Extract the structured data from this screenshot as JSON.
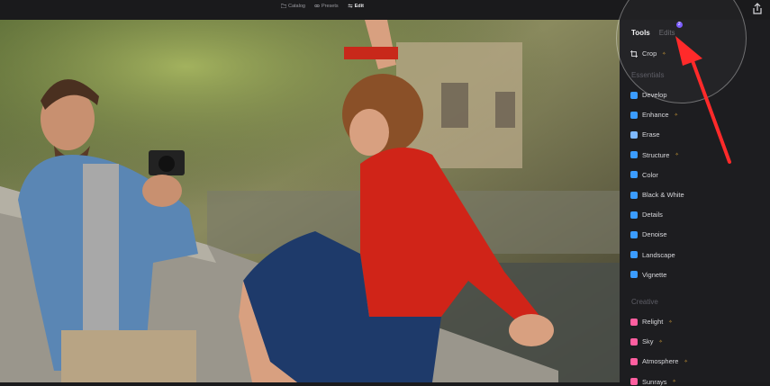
{
  "topbar": {
    "modes": [
      {
        "label": "Catalog",
        "icon": "folder-icon"
      },
      {
        "label": "Presets",
        "icon": "presets-icon"
      },
      {
        "label": "Edit",
        "icon": "edit-sliders-icon",
        "active": true
      }
    ]
  },
  "panel": {
    "tabs": {
      "tools": "Tools",
      "edits": "Edits",
      "edits_badge": "2"
    },
    "crop": "Crop",
    "sections": {
      "essentials": "Essentials",
      "creative": "Creative"
    },
    "essentials_items": [
      {
        "label": "Develop",
        "icon": "develop-icon",
        "color": "#3b9cff",
        "ai": false
      },
      {
        "label": "Enhance",
        "icon": "enhance-icon",
        "color": "#3b9cff",
        "ai": true
      },
      {
        "label": "Erase",
        "icon": "erase-icon",
        "color": "#7fb9ff",
        "ai": false
      },
      {
        "label": "Structure",
        "icon": "structure-icon",
        "color": "#3b9cff",
        "ai": true
      },
      {
        "label": "Color",
        "icon": "color-icon",
        "color": "#3b9cff",
        "ai": false
      },
      {
        "label": "Black & White",
        "icon": "black-white-icon",
        "color": "#3b9cff",
        "ai": false
      },
      {
        "label": "Details",
        "icon": "details-icon",
        "color": "#3b9cff",
        "ai": false
      },
      {
        "label": "Denoise",
        "icon": "denoise-icon",
        "color": "#3b9cff",
        "ai": false
      },
      {
        "label": "Landscape",
        "icon": "landscape-icon",
        "color": "#3b9cff",
        "ai": false
      },
      {
        "label": "Vignette",
        "icon": "vignette-icon",
        "color": "#3b9cff",
        "ai": false
      }
    ],
    "creative_items": [
      {
        "label": "Relight",
        "icon": "relight-icon",
        "color": "#ff5fa0",
        "ai": true
      },
      {
        "label": "Sky",
        "icon": "sky-icon",
        "color": "#ff5fa0",
        "ai": true
      },
      {
        "label": "Atmosphere",
        "icon": "atmosphere-icon",
        "color": "#ff5fa0",
        "ai": true
      },
      {
        "label": "Sunrays",
        "icon": "sunrays-icon",
        "color": "#ff5fa0",
        "ai": true
      }
    ],
    "ai_marker": "✧"
  },
  "colors": {
    "accent_blue": "#3b9cff",
    "accent_pink": "#ff5fa0",
    "annotation_red": "#ff2a2a",
    "badge_purple": "#7b5cff"
  }
}
